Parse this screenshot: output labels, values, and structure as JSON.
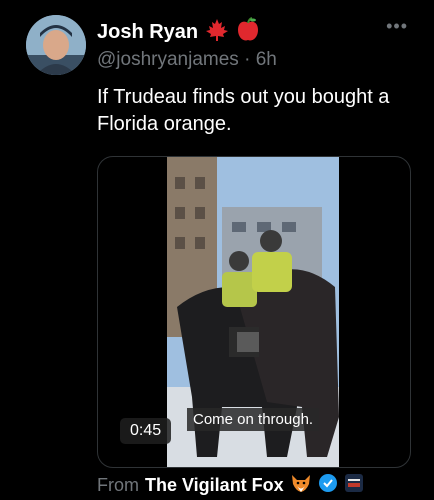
{
  "tweet": {
    "display_name": "Josh Ryan",
    "handle": "@joshryanjames",
    "separator": "·",
    "time_ago": "6h",
    "text": "If Trudeau finds out you bought a Florida orange."
  },
  "media": {
    "duration": "0:45",
    "caption": "Come on through."
  },
  "source": {
    "prefix": "From",
    "name": "The Vigilant Fox"
  },
  "icons": {
    "maple_leaf": "maple-leaf-icon",
    "apple": "apple-icon",
    "more": "more-options-icon",
    "fox": "fox-emoji-icon",
    "verified": "verified-badge-icon",
    "affiliate": "affiliate-badge-icon"
  },
  "colors": {
    "background": "#000000",
    "text": "#e7e9ea",
    "muted": "#71767b",
    "verified": "#1d9bf0",
    "maple": "#e0282e",
    "apple": "#e0282e"
  }
}
